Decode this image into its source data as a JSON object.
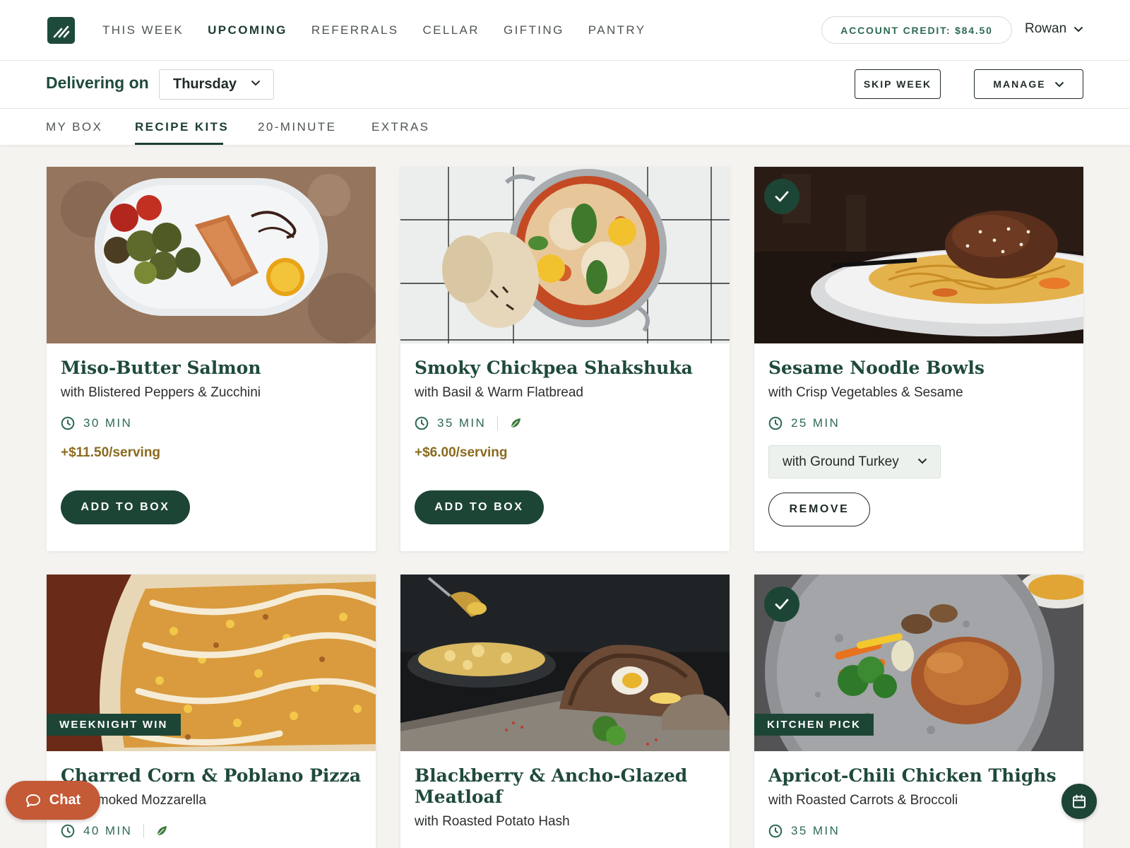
{
  "nav": {
    "items": [
      {
        "label": "THIS WEEK",
        "active": false
      },
      {
        "label": "UPCOMING",
        "active": true
      },
      {
        "label": "REFERRALS",
        "active": false
      },
      {
        "label": "CELLAR",
        "active": false
      },
      {
        "label": "GIFTING",
        "active": false
      },
      {
        "label": "PANTRY",
        "active": false
      }
    ],
    "credit": "ACCOUNT CREDIT: $84.50",
    "user": "Rowan"
  },
  "delivery": {
    "label": "Delivering on",
    "day": "Thursday",
    "skip_label": "SKIP WEEK",
    "manage_label": "MANAGE"
  },
  "subtabs": [
    {
      "label": "MY BOX",
      "active": false
    },
    {
      "label": "RECIPE KITS",
      "active": true
    },
    {
      "label": "20-MINUTE",
      "active": false
    },
    {
      "label": "EXTRAS",
      "active": false
    }
  ],
  "recipes": [
    {
      "title": "Miso-Butter Salmon",
      "subtitle": "with Blistered Peppers & Zucchini",
      "time": "30 MIN",
      "vegetarian": false,
      "price": "+$11.50/serving",
      "action": "ADD TO BOX",
      "in_box": false
    },
    {
      "title": "Smoky Chickpea Shakshuka",
      "subtitle": "with Basil & Warm Flatbread",
      "time": "35 MIN",
      "vegetarian": true,
      "price": "+$6.00/serving",
      "action": "ADD TO BOX",
      "in_box": false
    },
    {
      "title": "Sesame Noodle Bowls",
      "subtitle": "with Crisp Vegetables & Sesame",
      "time": "25 MIN",
      "vegetarian": false,
      "protein": "with Ground Turkey",
      "action": "REMOVE",
      "in_box": true
    },
    {
      "title": "Charred Corn & Poblano Pizza",
      "subtitle": "with Smoked Mozzarella",
      "time": "40 MIN",
      "vegetarian": true,
      "badge": "WEEKNIGHT WIN",
      "in_box": false
    },
    {
      "title": "Blackberry & Ancho-Glazed Meatloaf",
      "subtitle": "with Roasted Potato Hash",
      "in_box": false
    },
    {
      "title": "Apricot-Chili Chicken Thighs",
      "subtitle": "with Roasted Carrots & Broccoli",
      "time": "35 MIN",
      "vegetarian": false,
      "badge": "KITCHEN PICK",
      "in_box": true
    }
  ],
  "chat": {
    "label": "Chat"
  },
  "icons": {
    "logo": "brand-logo",
    "clock": "clock-icon",
    "leaf": "leaf-icon",
    "check": "check-icon",
    "chevron": "chevron-down-icon",
    "chat": "chat-bubble-icon",
    "calendar": "calendar-icon"
  },
  "colors": {
    "brand_green": "#1d4536",
    "accent_green": "#2e6a52",
    "price_gold": "#8a6a1e",
    "chat_orange": "#c45a36",
    "page_bg": "#f4f3f0"
  }
}
